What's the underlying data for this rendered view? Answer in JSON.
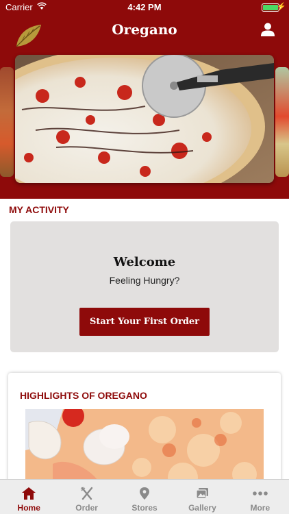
{
  "status_bar": {
    "carrier": "Carrier",
    "time": "4:42 PM"
  },
  "header": {
    "title": "Oregano"
  },
  "activity": {
    "section_title": "MY ACTIVITY",
    "welcome": "Welcome",
    "subtitle": "Feeling Hungry?",
    "cta_label": "Start Your First Order"
  },
  "highlights": {
    "title": "HIGHLIGHTS OF OREGANO"
  },
  "tabs": [
    {
      "label": "Home",
      "icon": "home-icon",
      "active": true
    },
    {
      "label": "Order",
      "icon": "utensils-icon",
      "active": false
    },
    {
      "label": "Stores",
      "icon": "location-pin-icon",
      "active": false
    },
    {
      "label": "Gallery",
      "icon": "gallery-icon",
      "active": false
    },
    {
      "label": "More",
      "icon": "more-dots-icon",
      "active": false
    }
  ],
  "colors": {
    "brand": "#8e0a0a",
    "card_bg": "#e2e0df",
    "tab_inactive": "#8a8a8a"
  }
}
